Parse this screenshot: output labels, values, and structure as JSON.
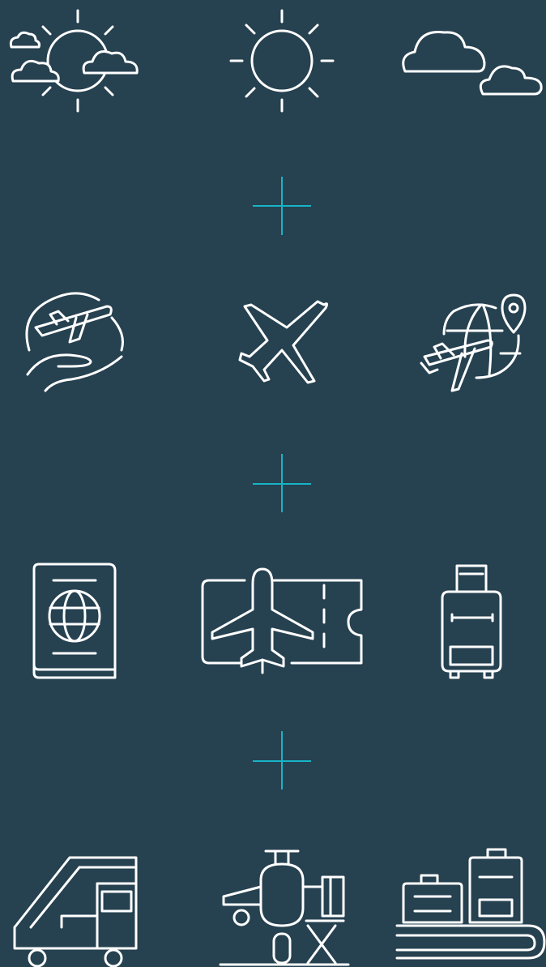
{
  "background_color": "#264150",
  "icon_color": "#ffffff",
  "accent_color": "#16b5c6",
  "rows": [
    {
      "name": "weather",
      "icons": [
        "sun-behind-clouds-icon",
        "sun-icon",
        "clouds-icon"
      ]
    },
    {
      "name": "flight",
      "icons": [
        "hand-holding-plane-icon",
        "airplane-icon",
        "globe-plane-location-pin-icon"
      ]
    },
    {
      "name": "documents",
      "icons": [
        "passport-icon",
        "boarding-pass-ticket-icon",
        "suitcase-icon"
      ]
    },
    {
      "name": "airport-services",
      "icons": [
        "boarding-stairs-truck-icon",
        "plane-catering-loader-icon",
        "baggage-carousel-icon"
      ]
    }
  ],
  "separators": [
    "plus-separator-icon",
    "plus-separator-icon",
    "plus-separator-icon"
  ]
}
